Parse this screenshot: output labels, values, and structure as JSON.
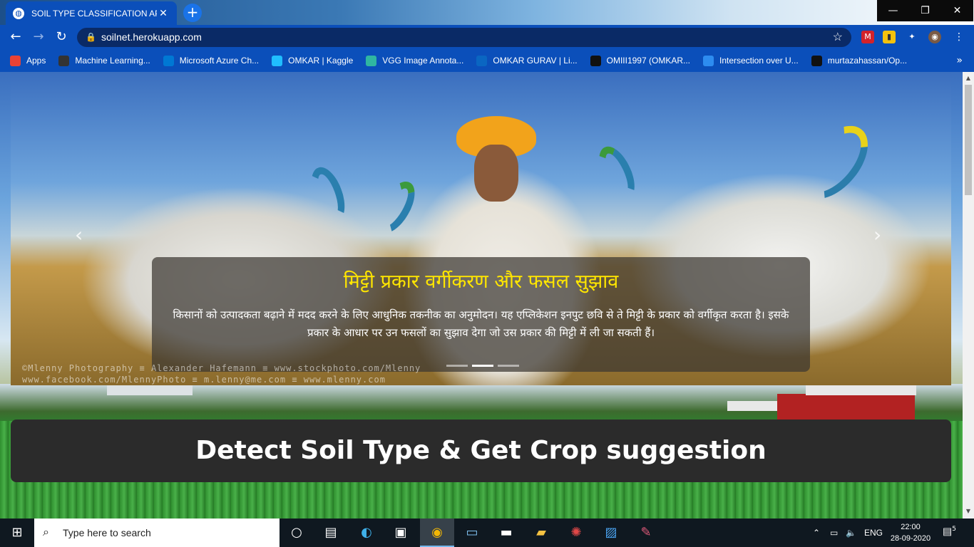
{
  "browser": {
    "tab_title": "SOIL TYPE CLASSIFICATION API",
    "tab_close": "✕",
    "new_tab": "+",
    "url": "soilnet.herokuapp.com",
    "window": {
      "minimize": "—",
      "maximize": "❐",
      "close": "✕"
    },
    "nav": {
      "back": "←",
      "forward": "→",
      "reload": "↻"
    },
    "extensions": [
      "M",
      "▮",
      "✦",
      "◉"
    ],
    "bookmarks": [
      {
        "label": "Apps",
        "icon": "apps-grid-icon",
        "color": "#e94235"
      },
      {
        "label": "Machine Learning...",
        "icon": "tds-icon",
        "color": "#333333"
      },
      {
        "label": "Microsoft Azure Ch...",
        "icon": "azure-icon",
        "color": "#0078d4"
      },
      {
        "label": "OMKAR | Kaggle",
        "icon": "kaggle-icon",
        "color": "#20beff"
      },
      {
        "label": "VGG Image Annota...",
        "icon": "vgg-icon",
        "color": "#2fb6a1"
      },
      {
        "label": "OMKAR GURAV | Li...",
        "icon": "linkedin-icon",
        "color": "#0a66c2"
      },
      {
        "label": "OMIII1997 (OMKAR...",
        "icon": "github-icon",
        "color": "#111111"
      },
      {
        "label": "Intersection over U...",
        "icon": "pyimagesearch-icon",
        "color": "#2d8cf0"
      },
      {
        "label": "murtazahassan/Op...",
        "icon": "github-icon",
        "color": "#111111"
      }
    ],
    "bookmarks_more": "»"
  },
  "page": {
    "carousel": {
      "caption_title": "मिट्टी प्रकार वर्गीकरण और फसल सुझाव",
      "caption_text": "किसानों को उत्पादकता बढ़ाने में मदद करने के लिए आधुनिक तकनीक का अनुमोदन। यह एप्लिकेशन इनपुट छवि से ते मिट्टी के प्रकार को वर्गीकृत करता है। इसके प्रकार के आधार पर उन फसलों का सुझाव देगा जो उस प्रकार की मिट्टी में ली जा सकती हैं।",
      "watermark_line1": "©Mlenny Photography ≡ Alexander Hafemann ≡ www.stockphoto.com/Mlenny",
      "watermark_line2": "www.facebook.com/MlennyPhoto ≡ m.lenny@me.com ≡ www.mlenny.com",
      "prev": "‹",
      "next": "›",
      "active_indicator": 1,
      "indicator_count": 3
    },
    "banner_title": "Detect Soil Type & Get Crop suggestion"
  },
  "taskbar": {
    "search_placeholder": "Type here to search",
    "language": "ENG",
    "time": "22:00",
    "date": "28-09-2020",
    "notifications": "5"
  }
}
